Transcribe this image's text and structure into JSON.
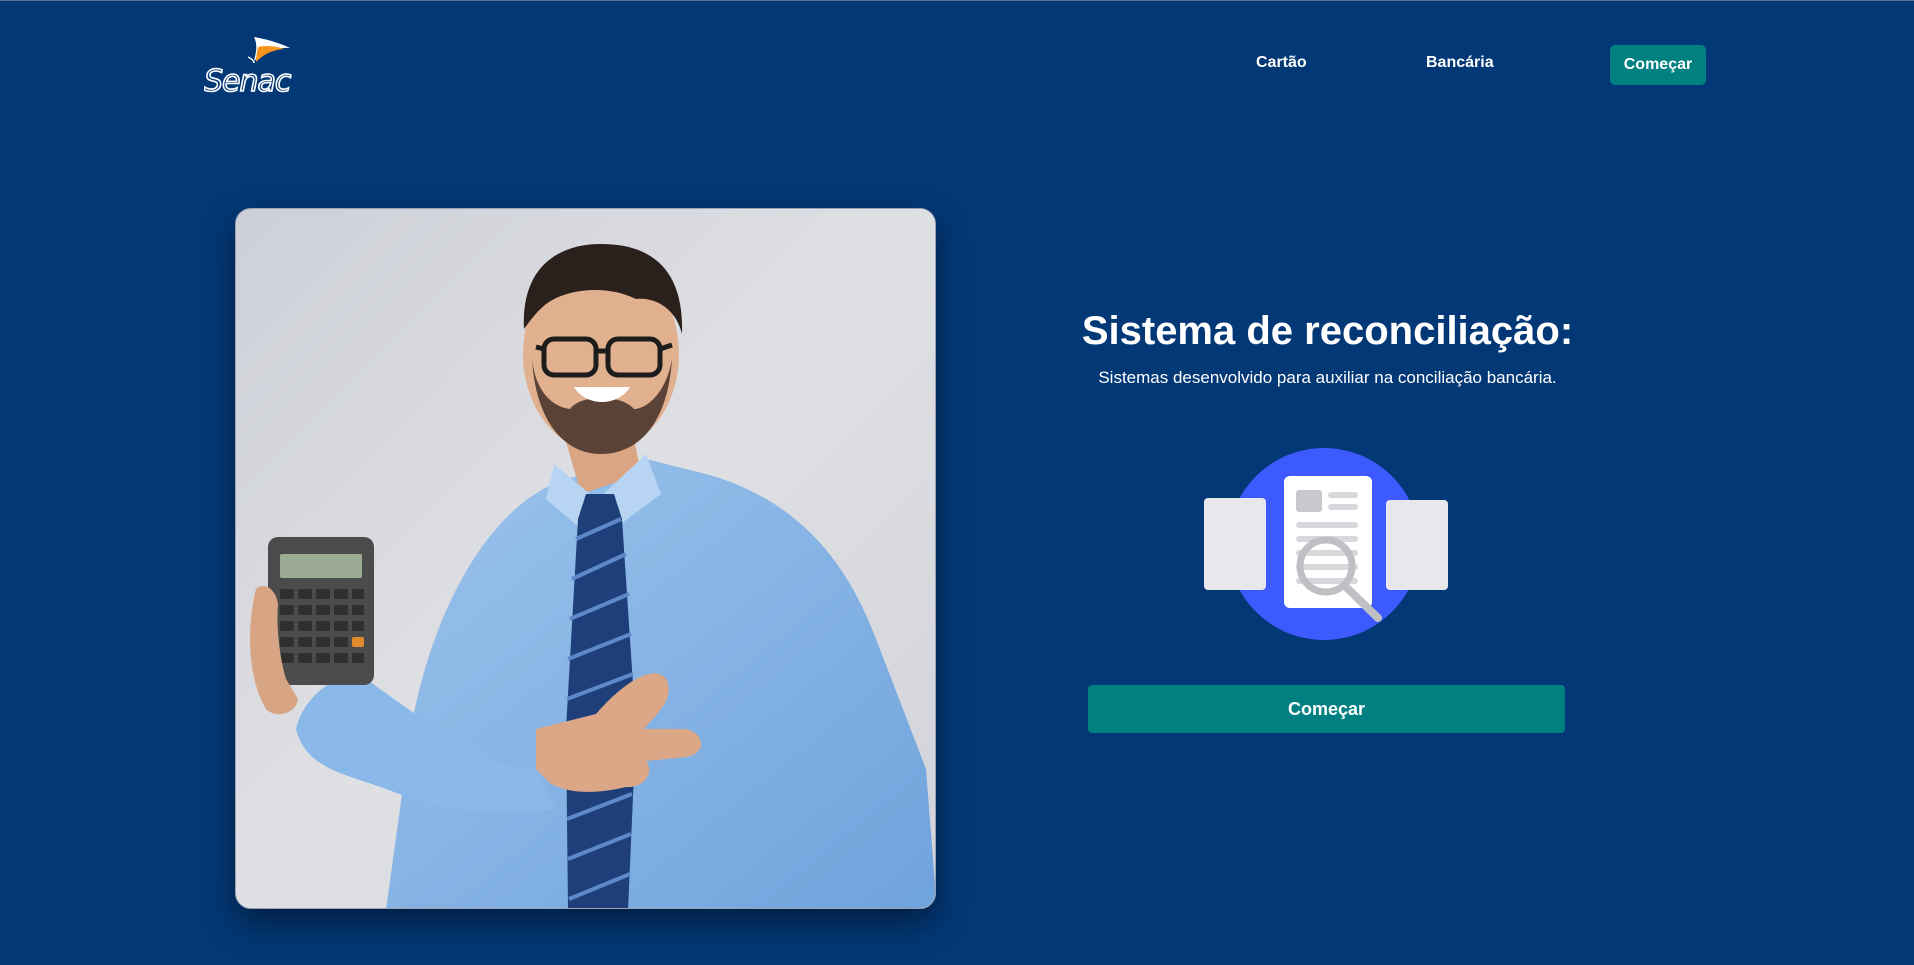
{
  "brand": {
    "logo_text": "Senac",
    "colors": {
      "page_background": "#033876",
      "accent": "#008080",
      "logo_orange": "#f7941d",
      "illustration_blue": "#3d5afe"
    }
  },
  "header": {
    "nav": [
      {
        "label": "Cartão"
      },
      {
        "label": "Bancária"
      }
    ],
    "cta_label": "Começar"
  },
  "hero": {
    "title": "Sistema de reconciliação:",
    "subtitle": "Sistemas desenvolvido para auxiliar na conciliação bancária.",
    "cta_label": "Começar",
    "illustration_icon": "document-search-icon",
    "photo_subject": "smiling man in blue shirt holding a calculator and pointing at it"
  }
}
